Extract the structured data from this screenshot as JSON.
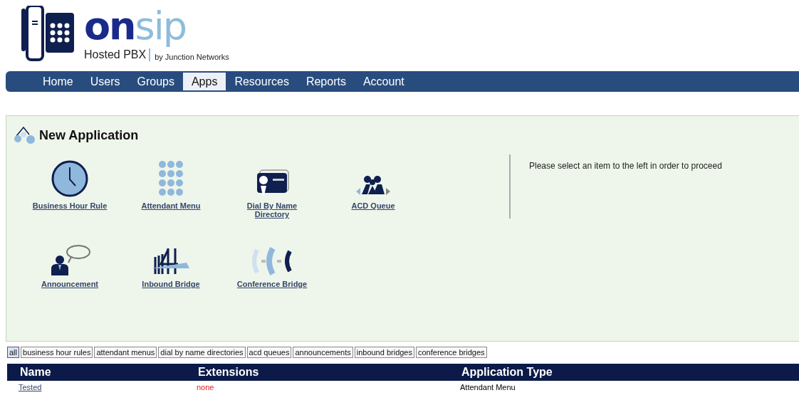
{
  "logo": {
    "name_dark": "on",
    "name_light": "sip",
    "product": "Hosted PBX",
    "byline": "by Junction Networks"
  },
  "nav": [
    {
      "label": "Home",
      "selected": false
    },
    {
      "label": "Users",
      "selected": false
    },
    {
      "label": "Groups",
      "selected": false
    },
    {
      "label": "Apps",
      "selected": true
    },
    {
      "label": "Resources",
      "selected": false
    },
    {
      "label": "Reports",
      "selected": false
    },
    {
      "label": "Account",
      "selected": false
    }
  ],
  "panel": {
    "title": "New Application",
    "message": "Please select an item to the left in order to proceed",
    "apps": [
      {
        "kind": "clock",
        "label": "Business Hour Rule"
      },
      {
        "kind": "keypad",
        "label": "Attendant Menu"
      },
      {
        "kind": "directory",
        "label": "Dial By Name Directory"
      },
      {
        "kind": "queue",
        "label": "ACD Queue"
      },
      {
        "kind": "announcement",
        "label": "Announcement"
      },
      {
        "kind": "bridge",
        "label": "Inbound Bridge"
      },
      {
        "kind": "conference",
        "label": "Conference Bridge"
      }
    ]
  },
  "filters": [
    {
      "label": "all",
      "selected": true
    },
    {
      "label": "business hour rules",
      "selected": false
    },
    {
      "label": "attendant menus",
      "selected": false
    },
    {
      "label": "dial by name directories",
      "selected": false
    },
    {
      "label": "acd queues",
      "selected": false
    },
    {
      "label": "announcements",
      "selected": false
    },
    {
      "label": "inbound bridges",
      "selected": false
    },
    {
      "label": "conference bridges",
      "selected": false
    }
  ],
  "table": {
    "columns": [
      "Name",
      "Extensions",
      "Application Type"
    ],
    "rows": [
      {
        "name": "Tested",
        "extensions": "none",
        "type": "Attendant Menu"
      }
    ]
  }
}
